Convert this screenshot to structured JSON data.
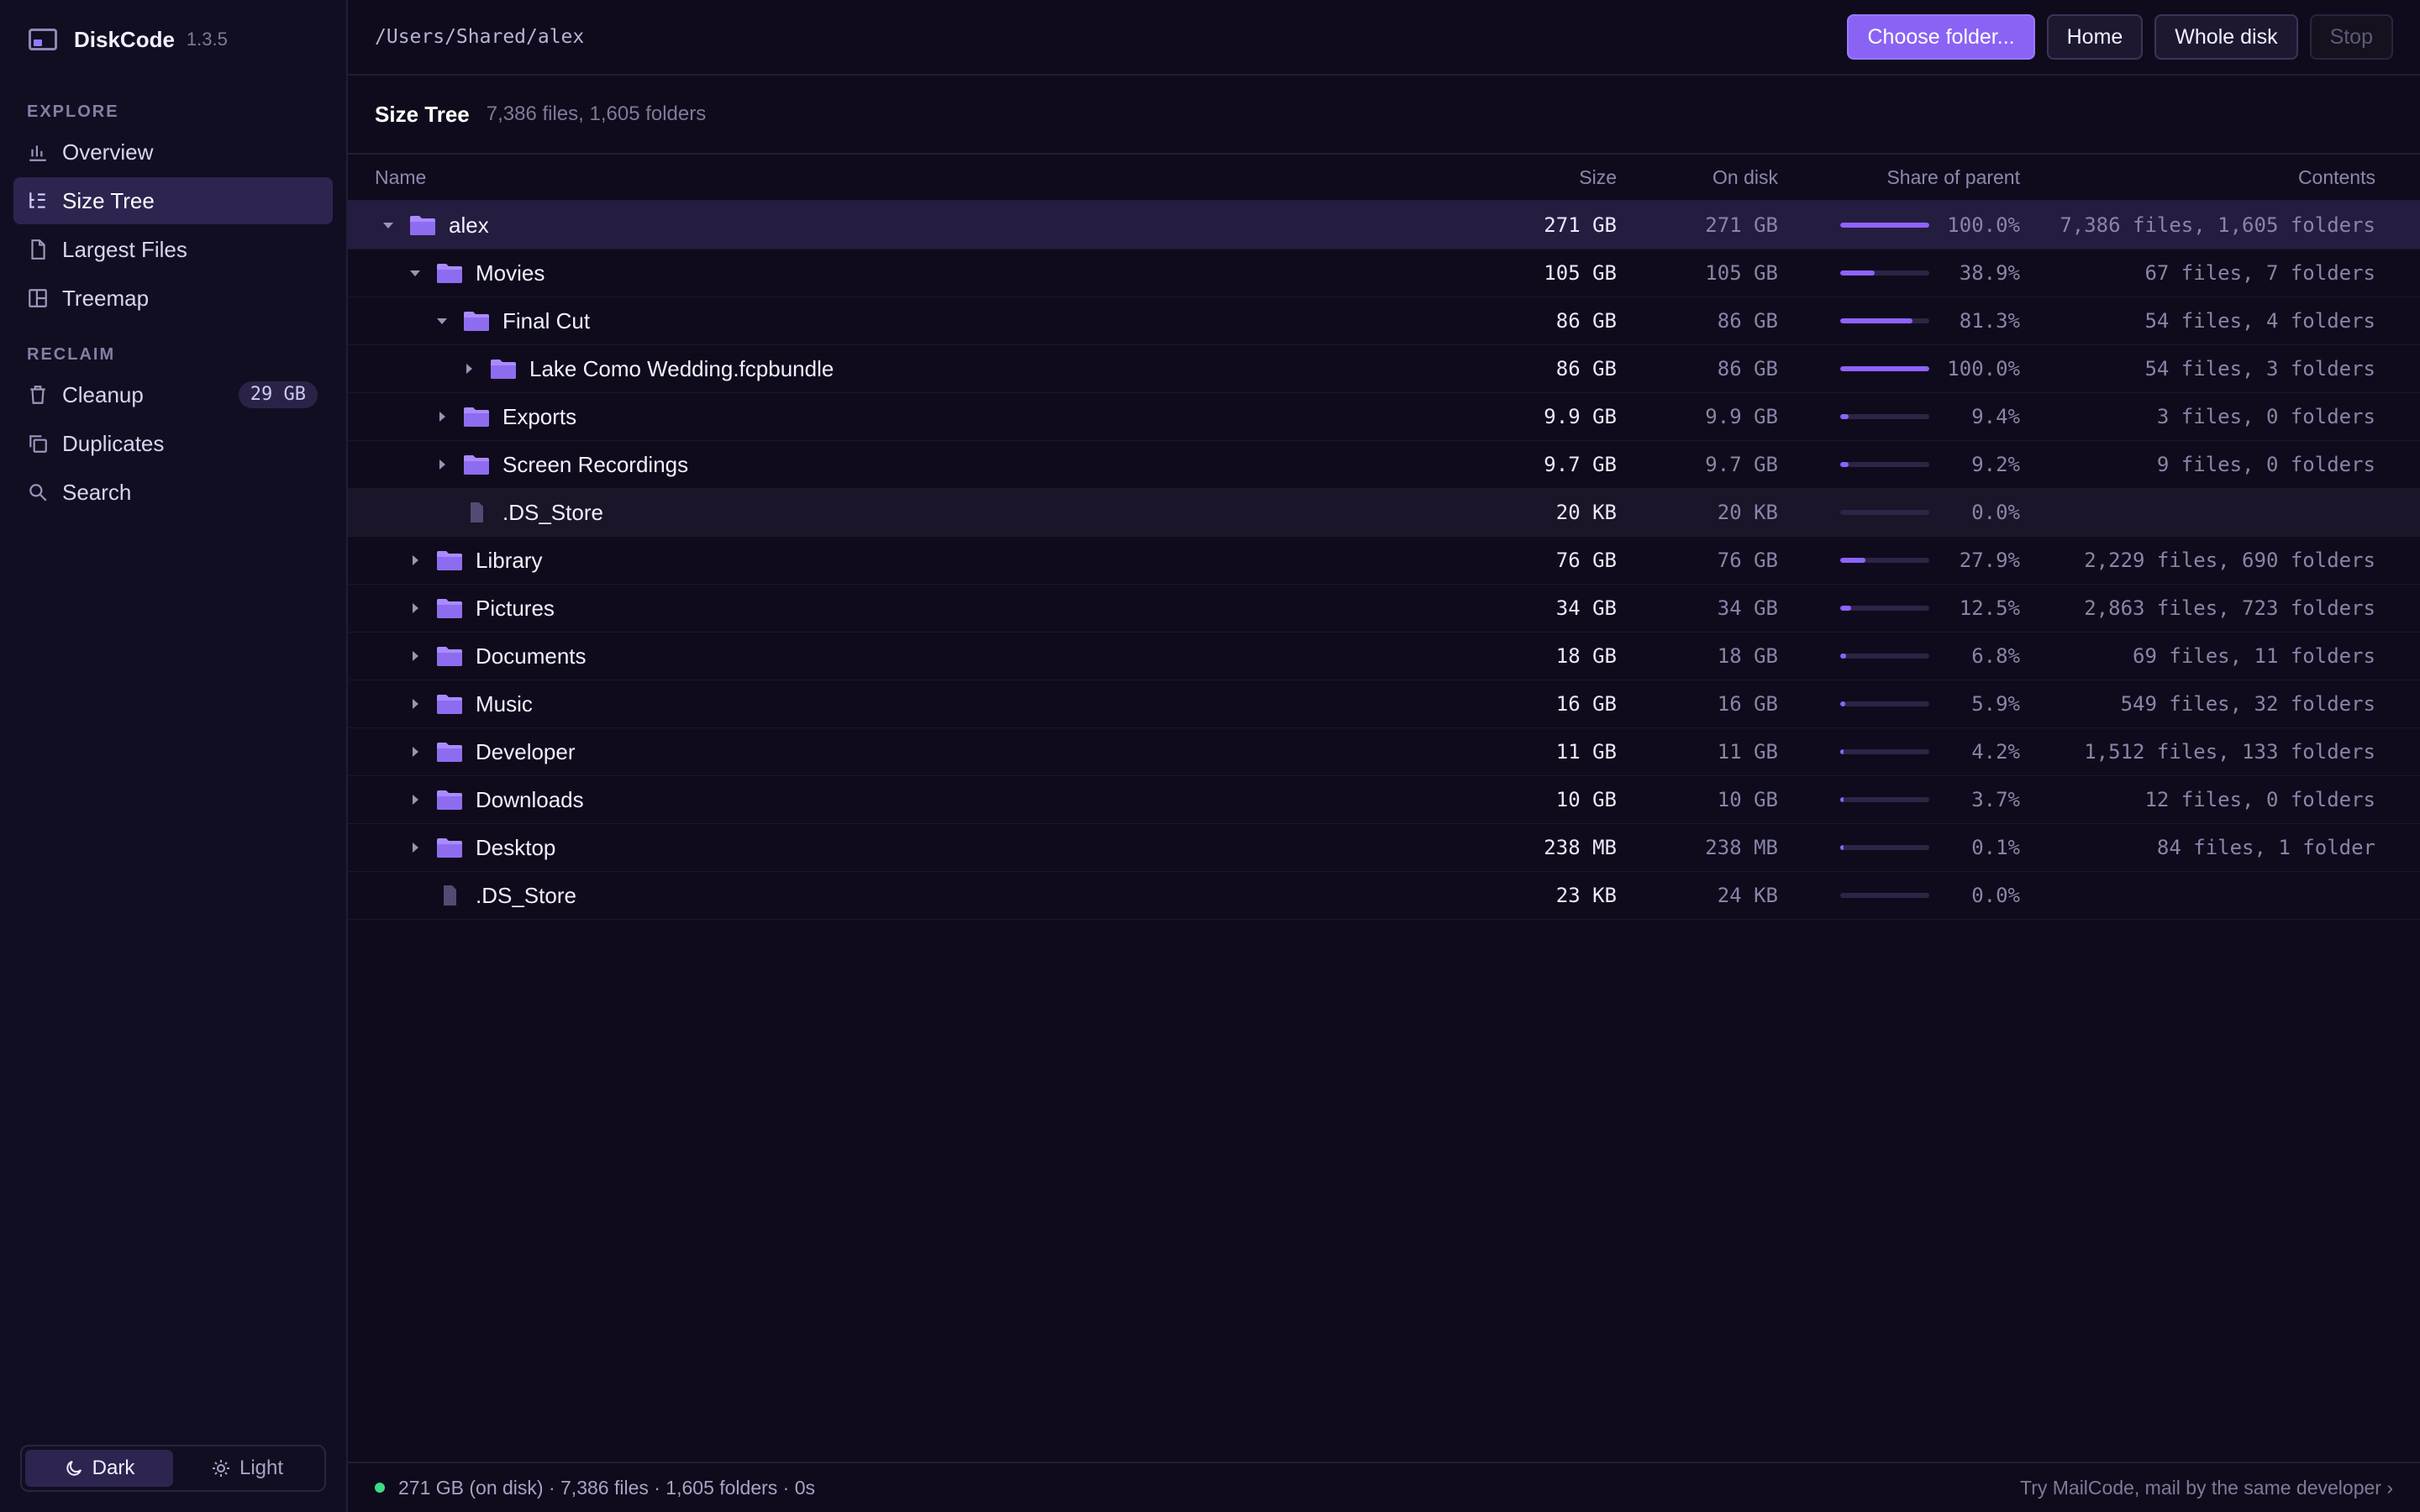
{
  "app": {
    "name": "DiskCode",
    "version": "1.3.5"
  },
  "sidebar": {
    "sections": [
      {
        "label": "EXPLORE",
        "items": [
          {
            "label": "Overview",
            "icon": "bar-chart-icon",
            "active": false
          },
          {
            "label": "Size Tree",
            "icon": "tree-list-icon",
            "active": true
          },
          {
            "label": "Largest Files",
            "icon": "file-icon",
            "active": false
          },
          {
            "label": "Treemap",
            "icon": "treemap-icon",
            "active": false
          }
        ]
      },
      {
        "label": "RECLAIM",
        "items": [
          {
            "label": "Cleanup",
            "icon": "trash-icon",
            "active": false,
            "badge": "29 GB"
          },
          {
            "label": "Duplicates",
            "icon": "copy-icon",
            "active": false
          },
          {
            "label": "Search",
            "icon": "search-icon",
            "active": false
          }
        ]
      }
    ],
    "theme": {
      "dark": "Dark",
      "light": "Light",
      "selected": "Dark"
    }
  },
  "toolbar": {
    "path": "/Users/Shared/alex",
    "choose_label": "Choose folder...",
    "home_label": "Home",
    "whole_disk_label": "Whole disk",
    "stop_label": "Stop"
  },
  "view": {
    "title": "Size Tree",
    "summary": "7,386 files, 1,605 folders"
  },
  "table": {
    "columns": {
      "name": "Name",
      "size": "Size",
      "on_disk": "On disk",
      "share": "Share of parent",
      "contents": "Contents"
    },
    "rows": [
      {
        "name": "alex",
        "type": "folder",
        "depth": 0,
        "expanded": true,
        "size": "271 GB",
        "on_disk": "271 GB",
        "share_pct": 100.0,
        "share": "100.0%",
        "contents": "7,386 files, 1,605 folders",
        "state": "selected"
      },
      {
        "name": "Movies",
        "type": "folder",
        "depth": 1,
        "expanded": true,
        "size": "105 GB",
        "on_disk": "105 GB",
        "share_pct": 38.9,
        "share": "38.9%",
        "contents": "67 files, 7 folders"
      },
      {
        "name": "Final Cut",
        "type": "folder",
        "depth": 2,
        "expanded": true,
        "size": "86 GB",
        "on_disk": "86 GB",
        "share_pct": 81.3,
        "share": "81.3%",
        "contents": "54 files, 4 folders"
      },
      {
        "name": "Lake Como Wedding.fcpbundle",
        "type": "folder",
        "depth": 3,
        "expanded": false,
        "size": "86 GB",
        "on_disk": "86 GB",
        "share_pct": 100.0,
        "share": "100.0%",
        "contents": "54 files, 3 folders"
      },
      {
        "name": "Exports",
        "type": "folder",
        "depth": 2,
        "expanded": false,
        "size": "9.9 GB",
        "on_disk": "9.9 GB",
        "share_pct": 9.4,
        "share": "9.4%",
        "contents": "3 files, 0 folders"
      },
      {
        "name": "Screen Recordings",
        "type": "folder",
        "depth": 2,
        "expanded": false,
        "size": "9.7 GB",
        "on_disk": "9.7 GB",
        "share_pct": 9.2,
        "share": "9.2%",
        "contents": "9 files, 0 folders"
      },
      {
        "name": ".DS_Store",
        "type": "file",
        "depth": 2,
        "size": "20 KB",
        "on_disk": "20 KB",
        "share_pct": 0.0,
        "share": "0.0%",
        "contents": "",
        "state": "hover"
      },
      {
        "name": "Library",
        "type": "folder",
        "depth": 1,
        "expanded": false,
        "size": "76 GB",
        "on_disk": "76 GB",
        "share_pct": 27.9,
        "share": "27.9%",
        "contents": "2,229 files, 690 folders"
      },
      {
        "name": "Pictures",
        "type": "folder",
        "depth": 1,
        "expanded": false,
        "size": "34 GB",
        "on_disk": "34 GB",
        "share_pct": 12.5,
        "share": "12.5%",
        "contents": "2,863 files, 723 folders"
      },
      {
        "name": "Documents",
        "type": "folder",
        "depth": 1,
        "expanded": false,
        "size": "18 GB",
        "on_disk": "18 GB",
        "share_pct": 6.8,
        "share": "6.8%",
        "contents": "69 files, 11 folders"
      },
      {
        "name": "Music",
        "type": "folder",
        "depth": 1,
        "expanded": false,
        "size": "16 GB",
        "on_disk": "16 GB",
        "share_pct": 5.9,
        "share": "5.9%",
        "contents": "549 files, 32 folders"
      },
      {
        "name": "Developer",
        "type": "folder",
        "depth": 1,
        "expanded": false,
        "size": "11 GB",
        "on_disk": "11 GB",
        "share_pct": 4.2,
        "share": "4.2%",
        "contents": "1,512 files, 133 folders"
      },
      {
        "name": "Downloads",
        "type": "folder",
        "depth": 1,
        "expanded": false,
        "size": "10 GB",
        "on_disk": "10 GB",
        "share_pct": 3.7,
        "share": "3.7%",
        "contents": "12 files, 0 folders"
      },
      {
        "name": "Desktop",
        "type": "folder",
        "depth": 1,
        "expanded": false,
        "size": "238 MB",
        "on_disk": "238 MB",
        "share_pct": 0.1,
        "share": "0.1%",
        "contents": "84 files, 1 folder"
      },
      {
        "name": ".DS_Store",
        "type": "file",
        "depth": 1,
        "size": "23 KB",
        "on_disk": "24 KB",
        "share_pct": 0.0,
        "share": "0.0%",
        "contents": ""
      }
    ]
  },
  "status": {
    "text": "271 GB (on disk) · 7,386 files · 1,605 folders · 0s",
    "promo": "Try MailCode, mail by the same developer ›",
    "indicator_color": "#3ddc84"
  },
  "colors": {
    "accent": "#8a63f5",
    "background": "#0f0b1c",
    "sidebar": "#120e22",
    "selected_row": "#241d40"
  }
}
